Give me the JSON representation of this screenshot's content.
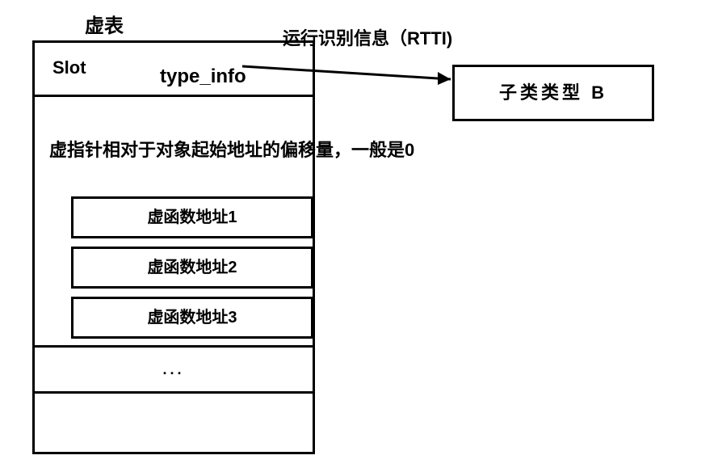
{
  "titles": {
    "vtable": "虚表",
    "rtti": "运行识别信息（RTTI)"
  },
  "vtable": {
    "slot_label": "Slot",
    "typeinfo_label": "type_info",
    "offset_text": "虚指针相对于对象起始地址的偏移量，一般是0",
    "func_rows": {
      "f1": "虚函数地址1",
      "f2": "虚函数地址2",
      "f3": "虚函数地址3"
    },
    "more": "..."
  },
  "subclass_box": "子类类型  B"
}
